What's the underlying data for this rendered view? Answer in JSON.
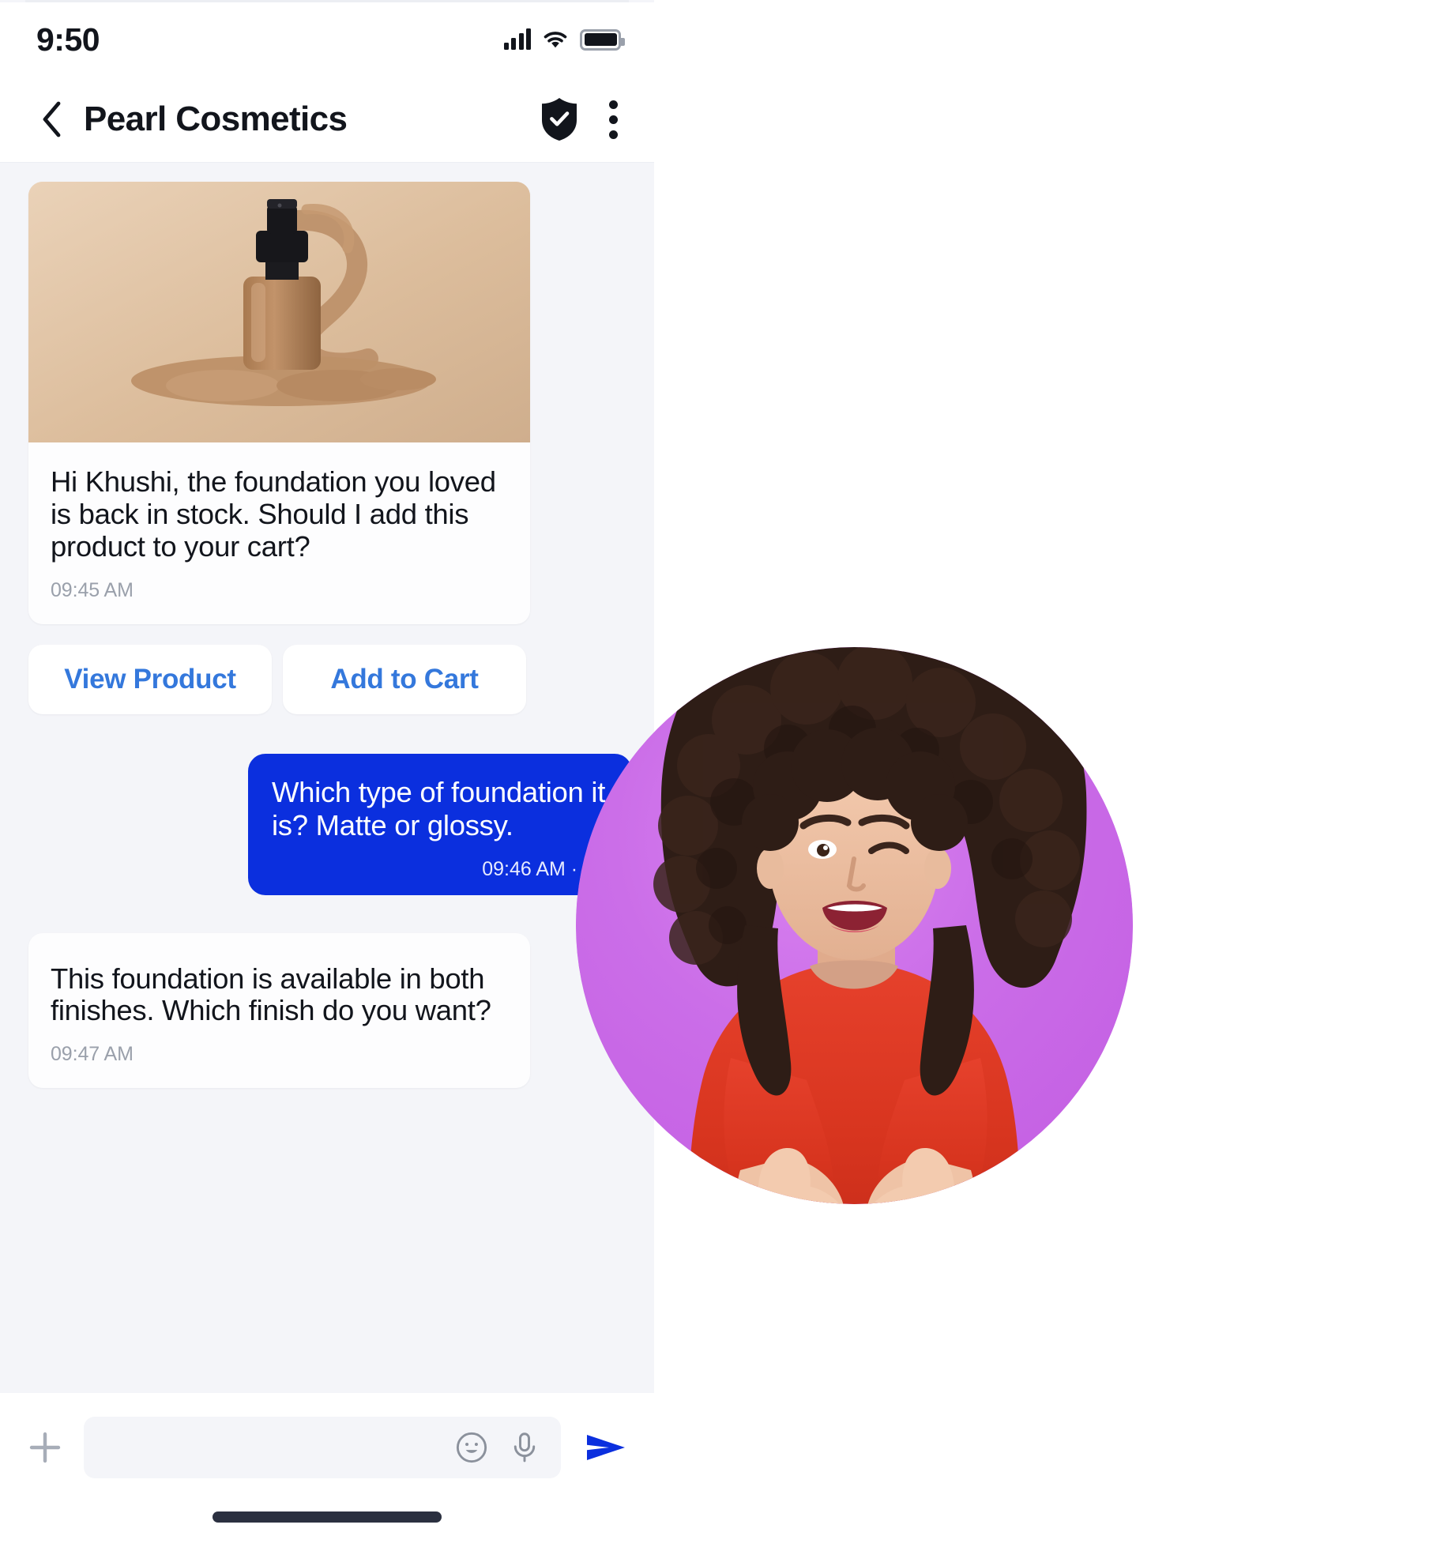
{
  "status_bar": {
    "time": "9:50",
    "signal_icon": "cellular-signal-icon",
    "wifi_icon": "wifi-icon",
    "battery_icon": "battery-icon"
  },
  "app_bar": {
    "back_icon": "back-chevron-icon",
    "title": "Pearl Cosmetics",
    "verified_icon": "shield-check-icon",
    "menu_icon": "kebab-menu-icon"
  },
  "conversation": {
    "messages": [
      {
        "id": "msg-product-card",
        "direction": "incoming",
        "has_image": true,
        "image_alt": "foundation-bottle-product-image",
        "text": "Hi Khushi, the foundation you loved is back in stock. Should I add this product to your cart?",
        "time": "09:45 AM"
      },
      {
        "id": "msg-outgoing-question",
        "direction": "outgoing",
        "has_image": false,
        "text": "Which type of foundation it is? Matte or glossy.",
        "time": "09:46 AM · Re"
      },
      {
        "id": "msg-incoming-answer",
        "direction": "incoming",
        "has_image": false,
        "text": "This foundation is available in both finishes. Which finish do you want?",
        "time": "09:47 AM"
      }
    ],
    "quick_replies": [
      {
        "label": "View Product"
      },
      {
        "label": "Add to Cart"
      }
    ]
  },
  "composer": {
    "attach_icon": "plus-icon",
    "input_value": "",
    "input_placeholder": "",
    "emoji_icon": "smiley-face-icon",
    "mic_icon": "microphone-icon",
    "send_icon": "send-paper-plane-icon"
  },
  "overlay": {
    "avatar_name": "woman-thumbs-up-photo",
    "circle_color": "#c867e5"
  },
  "colors": {
    "outgoing_bubble": "#0b2fde",
    "link_blue": "#3478dc",
    "chat_background": "#f4f5f9",
    "incoming_bubble": "#fdfdfe",
    "text_primary": "#12151c",
    "text_muted": "#9aa0ab"
  }
}
